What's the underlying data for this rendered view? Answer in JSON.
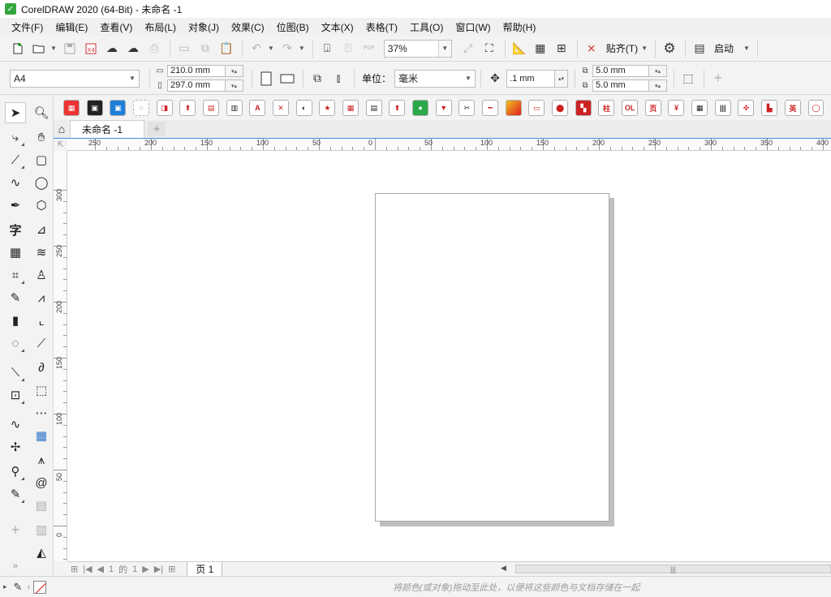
{
  "app": {
    "title": "CorelDRAW 2020 (64-Bit) - 未命名 -1"
  },
  "menu": [
    "文件(F)",
    "编辑(E)",
    "查看(V)",
    "布局(L)",
    "对象(J)",
    "效果(C)",
    "位图(B)",
    "文本(X)",
    "表格(T)",
    "工具(O)",
    "窗口(W)",
    "帮助(H)"
  ],
  "standard_toolbar": {
    "zoom_value": "37%",
    "snap_label": "贴齐(T)",
    "launch_label": "启动",
    "pdf_label": "PDF"
  },
  "property_bar": {
    "page_size": "A4",
    "width": "210.0 mm",
    "height": "297.0 mm",
    "units_label": "单位：",
    "units_value": "毫米",
    "nudge": ".1 mm",
    "dup_x": "5.0 mm",
    "dup_y": "5.0 mm"
  },
  "document_tab": {
    "name": "未命名 -1"
  },
  "ruler": {
    "h_labels": [
      "250",
      "200",
      "150",
      "100",
      "50",
      "0",
      "50",
      "100",
      "150",
      "200",
      "250",
      "300",
      "350",
      "400"
    ],
    "v_labels": [
      "300",
      "250",
      "200",
      "150",
      "100",
      "50",
      "0"
    ]
  },
  "page_nav": {
    "current": "1",
    "of_label": "的",
    "total": "1",
    "page_tab": "页 1"
  },
  "status": {
    "hint": "将颜色(或对象)拖动至此处，以便将这些颜色与文档存储在一起"
  },
  "colors": {
    "accent": "#3c8dde",
    "canvas": "#ffffff",
    "chrome": "#f3f3f3"
  }
}
